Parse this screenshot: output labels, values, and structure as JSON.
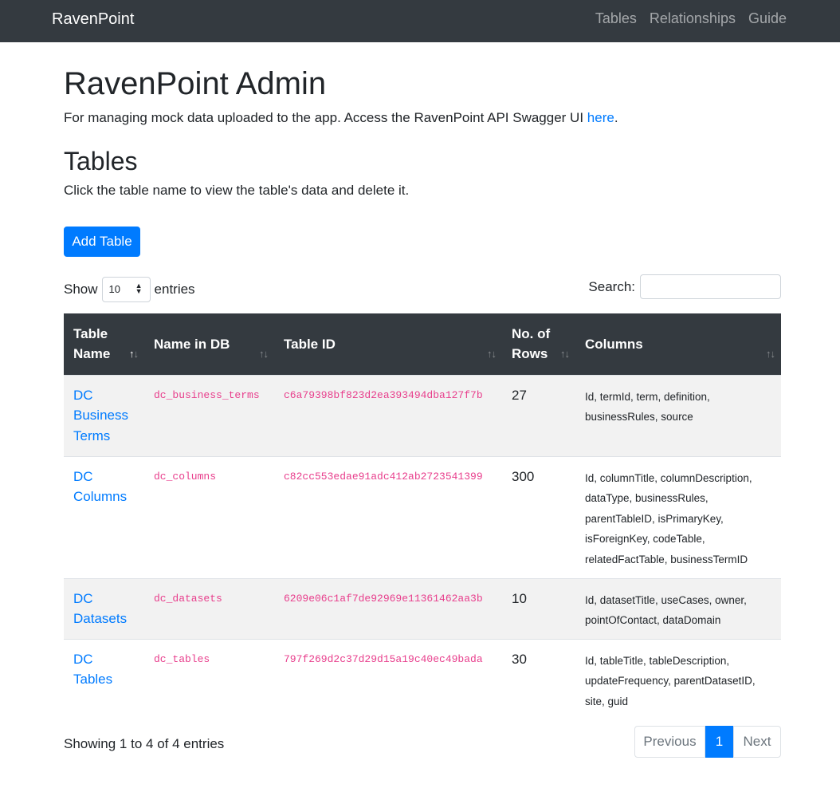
{
  "navbar": {
    "brand": "RavenPoint",
    "links": [
      "Tables",
      "Relationships",
      "Guide"
    ]
  },
  "header": {
    "title": "RavenPoint Admin",
    "lead_text": "For managing mock data uploaded to the app. Access the RavenPoint API Swagger UI ",
    "lead_link": "here",
    "lead_end": "."
  },
  "tables_section": {
    "title": "Tables",
    "subtitle": "Click the table name to view the table's data and delete it.",
    "add_button": "Add Table"
  },
  "controls": {
    "show_label": "Show",
    "entries_value": "10",
    "entries_label": "entries",
    "search_label": "Search:",
    "search_value": ""
  },
  "table": {
    "headers": [
      "Table Name",
      "Name in DB",
      "Table ID",
      "No. of Rows",
      "Columns"
    ],
    "rows": [
      {
        "name": "DC Business Terms",
        "db": "dc_business_terms",
        "id": "c6a79398bf823d2ea393494dba127f7b",
        "rows": "27",
        "columns": "Id, termId, term, definition, businessRules, source"
      },
      {
        "name": "DC Columns",
        "db": "dc_columns",
        "id": "c82cc553edae91adc412ab2723541399",
        "rows": "300",
        "columns": "Id, columnTitle, columnDescription, dataType, businessRules, parentTableID, isPrimaryKey, isForeignKey, codeTable, relatedFactTable, businessTermID"
      },
      {
        "name": "DC Datasets",
        "db": "dc_datasets",
        "id": "6209e06c1af7de92969e11361462aa3b",
        "rows": "10",
        "columns": "Id, datasetTitle, useCases, owner, pointOfContact, dataDomain"
      },
      {
        "name": "DC Tables",
        "db": "dc_tables",
        "id": "797f269d2c37d29d15a19c40ec49bada",
        "rows": "30",
        "columns": "Id, tableTitle, tableDescription, updateFrequency, parentDatasetID, site, guid"
      }
    ]
  },
  "footer": {
    "info": "Showing 1 to 4 of 4 entries",
    "prev": "Previous",
    "current": "1",
    "next": "Next"
  }
}
